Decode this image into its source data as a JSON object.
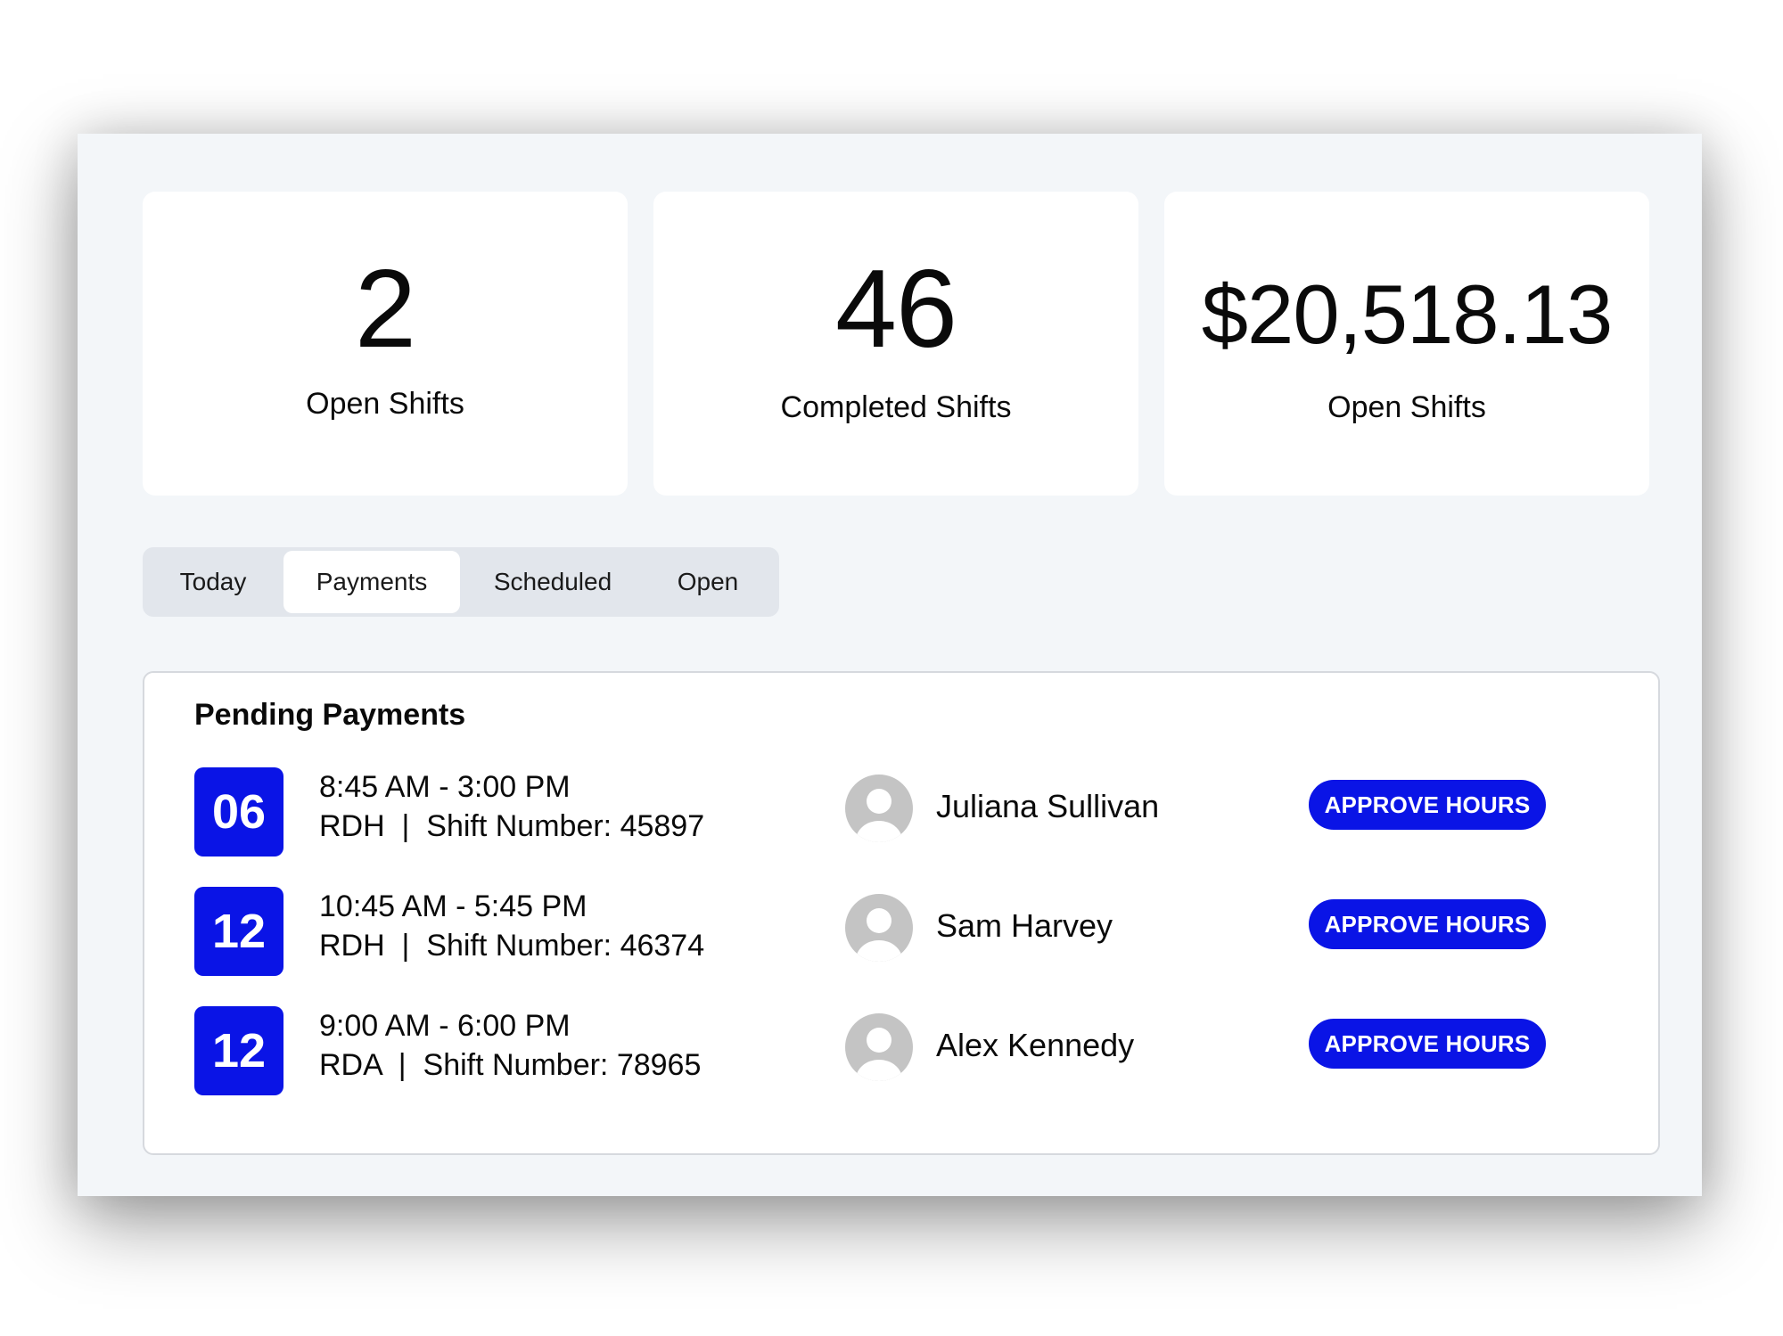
{
  "stats": [
    {
      "value": "2",
      "label": "Open Shifts"
    },
    {
      "value": "46",
      "label": "Completed Shifts"
    },
    {
      "value": "$20,518.13",
      "label": "Open Shifts"
    }
  ],
  "tabs": [
    {
      "label": "Today",
      "active": false
    },
    {
      "label": "Payments",
      "active": true
    },
    {
      "label": "Scheduled",
      "active": false
    },
    {
      "label": "Open",
      "active": false
    }
  ],
  "pending_payments": {
    "title": "Pending Payments",
    "rows": [
      {
        "day": "06",
        "time": "8:45 AM - 3:00 PM",
        "shift": "RDH  |  Shift Number: 45897",
        "name": "Juliana Sullivan",
        "action": "APPROVE HOURS"
      },
      {
        "day": "12",
        "time": "10:45 AM - 5:45 PM",
        "shift": "RDH  |  Shift Number: 46374",
        "name": "Sam Harvey",
        "action": "APPROVE HOURS"
      },
      {
        "day": "12",
        "time": "9:00 AM - 6:00 PM",
        "shift": "RDA  |  Shift Number: 78965",
        "name": "Alex Kennedy",
        "action": "APPROVE HOURS"
      }
    ]
  },
  "colors": {
    "accent": "#0a14e6",
    "panel_bg": "#f3f6f9",
    "tab_track": "#e2e6ec",
    "avatar": "#c4c4c4"
  },
  "icons": {
    "avatar": "user-avatar-icon"
  }
}
